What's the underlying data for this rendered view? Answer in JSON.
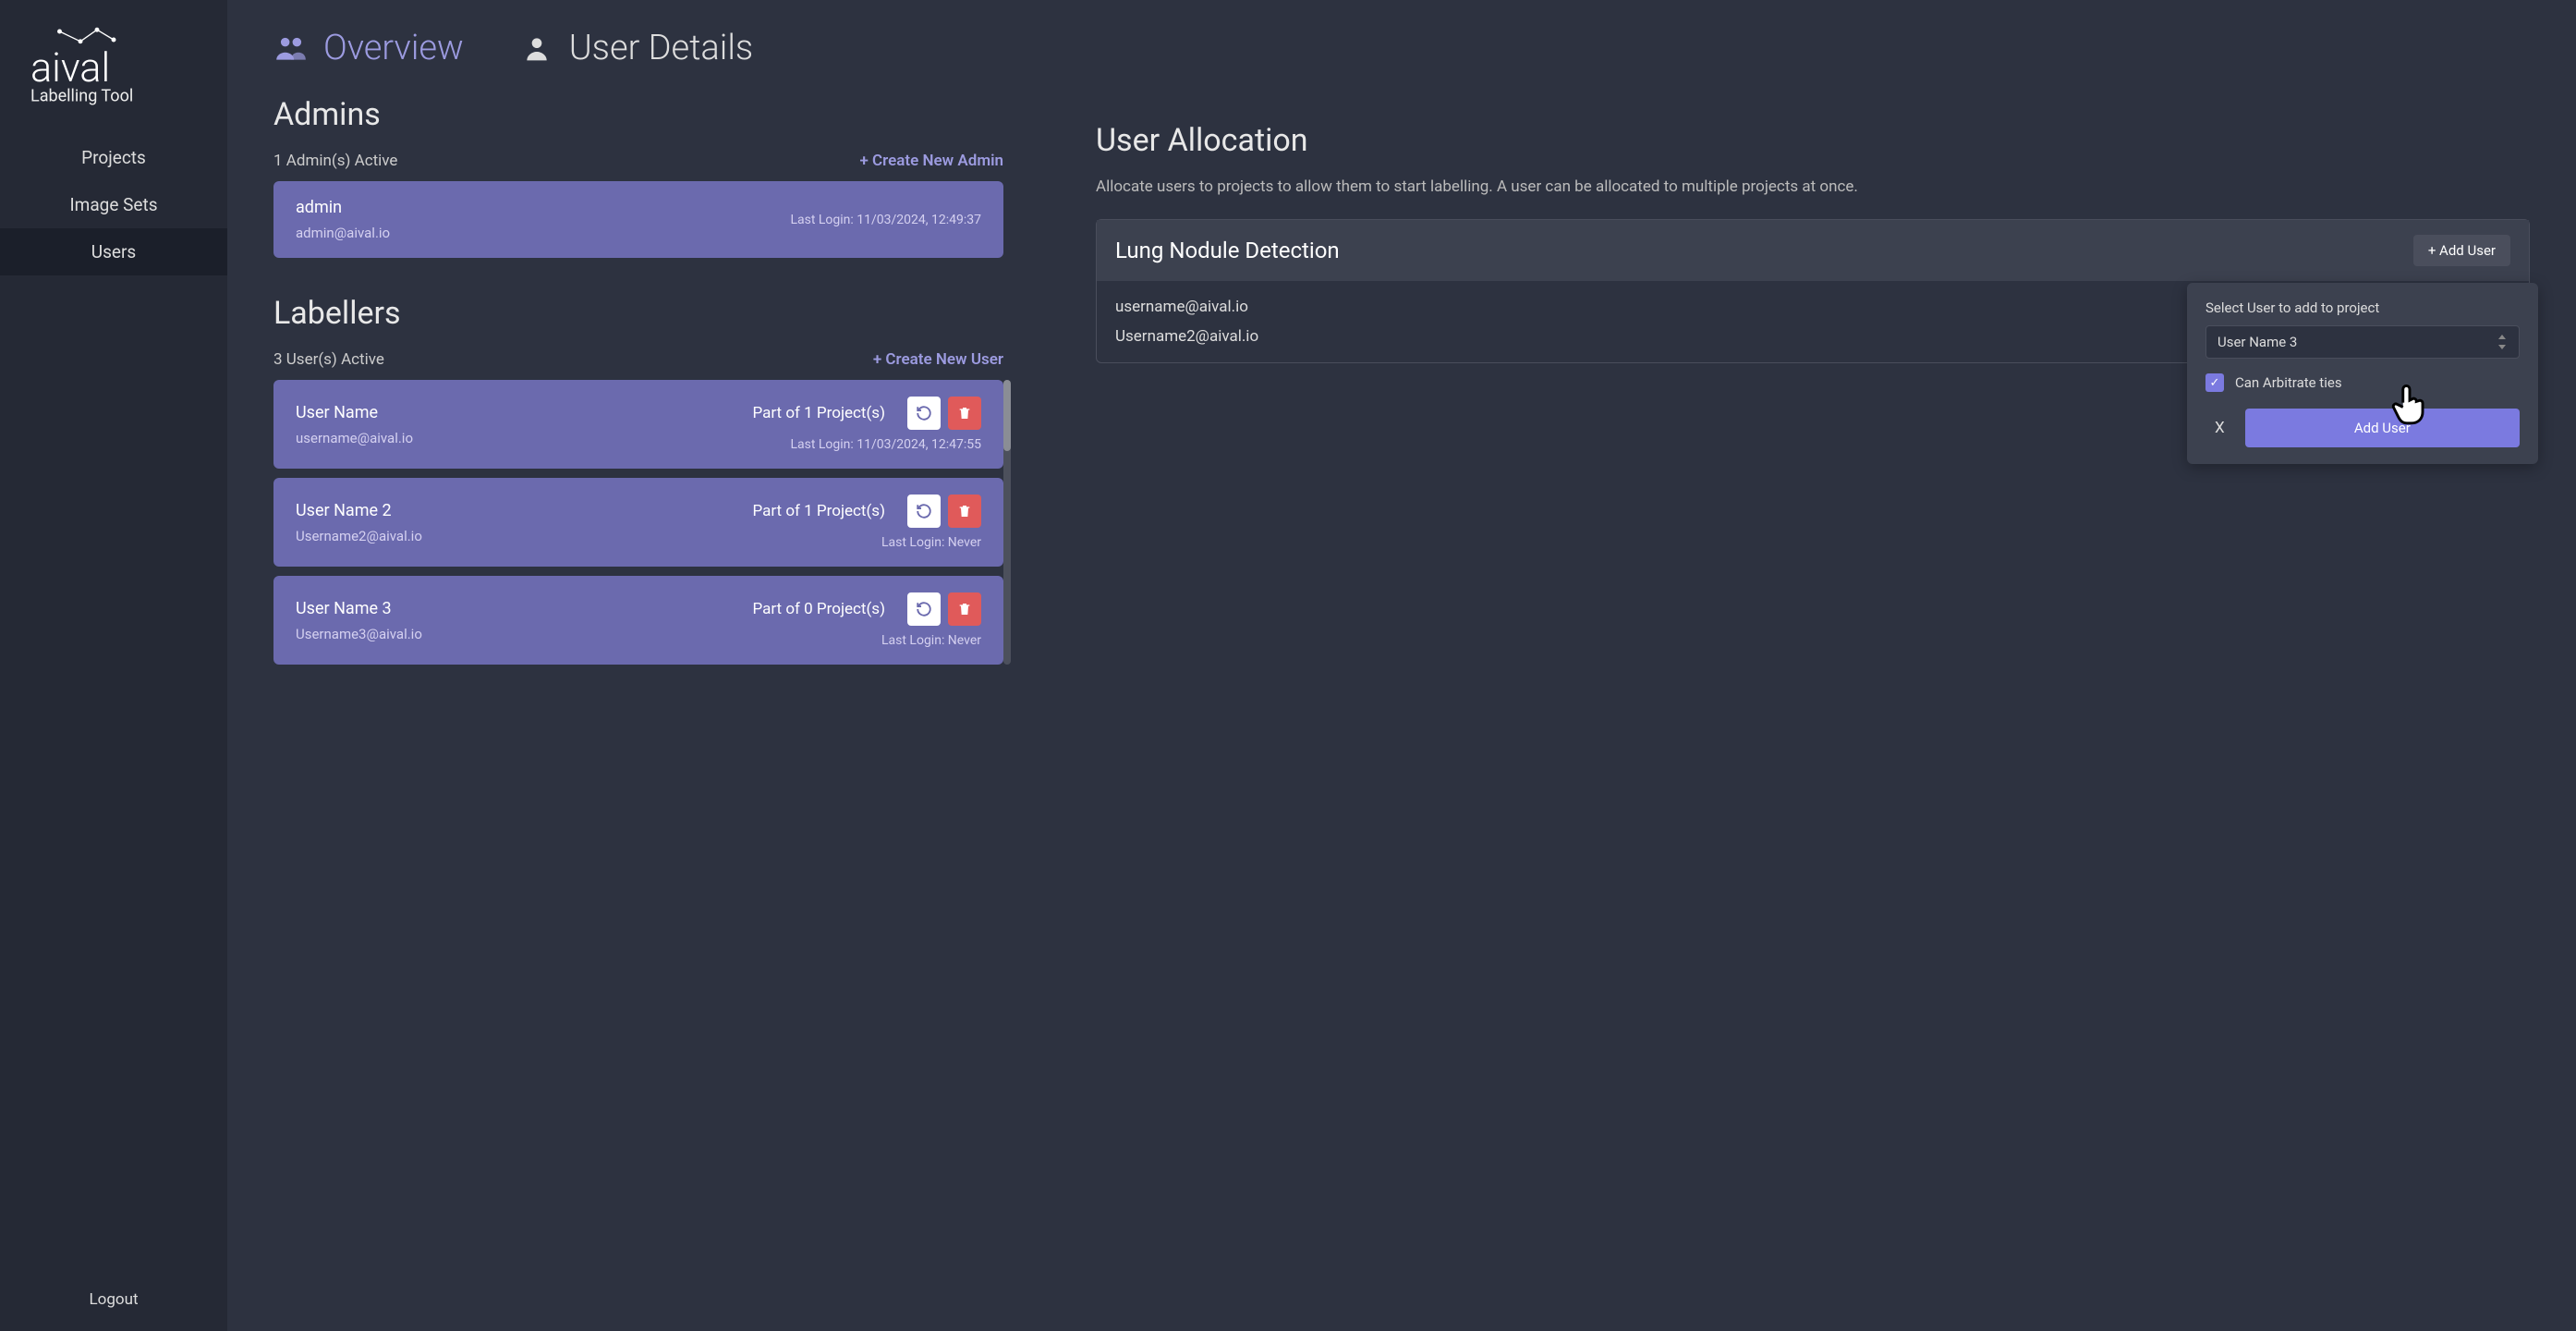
{
  "app": {
    "name": "aival",
    "subtitle": "Labelling Tool"
  },
  "sidebar": {
    "items": [
      {
        "label": "Projects"
      },
      {
        "label": "Image Sets"
      },
      {
        "label": "Users"
      }
    ],
    "logout": "Logout"
  },
  "tabs": [
    {
      "label": "Overview",
      "active": true
    },
    {
      "label": "User Details",
      "active": false
    }
  ],
  "admins": {
    "title": "Admins",
    "count_text": "1 Admin(s) Active",
    "create_label": "+ Create New Admin",
    "list": [
      {
        "name": "admin",
        "email": "admin@aival.io",
        "last_login": "Last Login: 11/03/2024, 12:49:37"
      }
    ]
  },
  "labellers": {
    "title": "Labellers",
    "count_text": "3 User(s) Active",
    "create_label": "+ Create New User",
    "list": [
      {
        "name": "User Name",
        "email": "username@aival.io",
        "projects": "Part of 1 Project(s)",
        "last_login": "Last Login: 11/03/2024, 12:47:55"
      },
      {
        "name": "User Name 2",
        "email": "Username2@aival.io",
        "projects": "Part of 1 Project(s)",
        "last_login": "Last Login: Never"
      },
      {
        "name": "User Name 3",
        "email": "Username3@aival.io",
        "projects": "Part of 0 Project(s)",
        "last_login": "Last Login: Never"
      }
    ]
  },
  "allocation": {
    "title": "User Allocation",
    "desc": "Allocate users to projects to allow them to start labelling. A user can be allocated to multiple projects at once.",
    "project": {
      "name": "Lung Nodule Detection",
      "add_button": "+ Add User",
      "users": [
        "username@aival.io",
        "Username2@aival.io"
      ]
    }
  },
  "popover": {
    "label": "Select User to add to project",
    "selected": "User Name 3",
    "checkbox_label": "Can Arbitrate ties",
    "close": "X",
    "submit": "Add User"
  }
}
